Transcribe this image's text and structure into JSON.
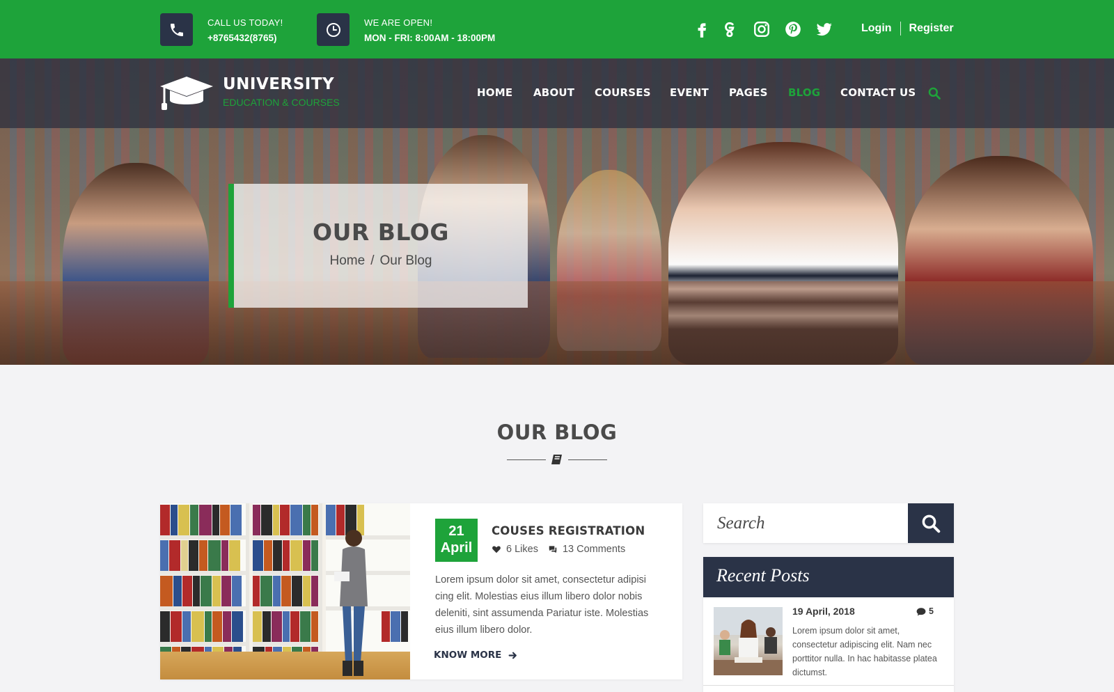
{
  "topbar": {
    "call_label": "CALL US TODAY!",
    "phone": "+8765432(8765)",
    "open_label": "WE ARE OPEN!",
    "hours": "MON - FRI: 8:00AM - 18:00PM",
    "social_icons": [
      "facebook-icon",
      "google-plus-icon",
      "instagram-icon",
      "pinterest-icon",
      "twitter-icon"
    ],
    "login": "Login",
    "register": "Register"
  },
  "brand": {
    "name": "UNIVERSITY",
    "tagline": "EDUCATION & COURSES"
  },
  "nav": {
    "items": [
      "HOME",
      "ABOUT",
      "COURSES",
      "EVENT",
      "PAGES",
      "BLOG",
      "CONTACT US"
    ],
    "active": "BLOG"
  },
  "hero": {
    "title": "OUR BLOG",
    "breadcrumb_home": "Home",
    "breadcrumb_sep": "/",
    "breadcrumb_current": "Our Blog"
  },
  "section": {
    "title": "OUR BLOG",
    "divider_icon": "book-icon"
  },
  "post": {
    "day": "21",
    "month": "April",
    "title": "COUSES REGISTRATION",
    "likes": "6 Likes",
    "comments": "13 Comments",
    "excerpt": "Lorem ipsum dolor sit amet, consectetur adipisi cing elit. Molestias eius illum libero dolor nobis deleniti, sint assumenda Pariatur iste. Molestias eius illum libero dolor.",
    "link": "KNOW MORE"
  },
  "sidebar": {
    "search_placeholder": "Search",
    "recent_title": "Recent Posts",
    "recent": [
      {
        "date": "19 April, 2018",
        "comments": "5",
        "text": "Lorem ipsum dolor sit amet, consectetur adipiscing elit. Nam nec porttitor nulla. In hac habitasse platea dictumst."
      }
    ]
  },
  "colors": {
    "accent_green": "#1ea33a",
    "dark_navy": "#2a3347",
    "page_bg": "#f3f3f5"
  }
}
